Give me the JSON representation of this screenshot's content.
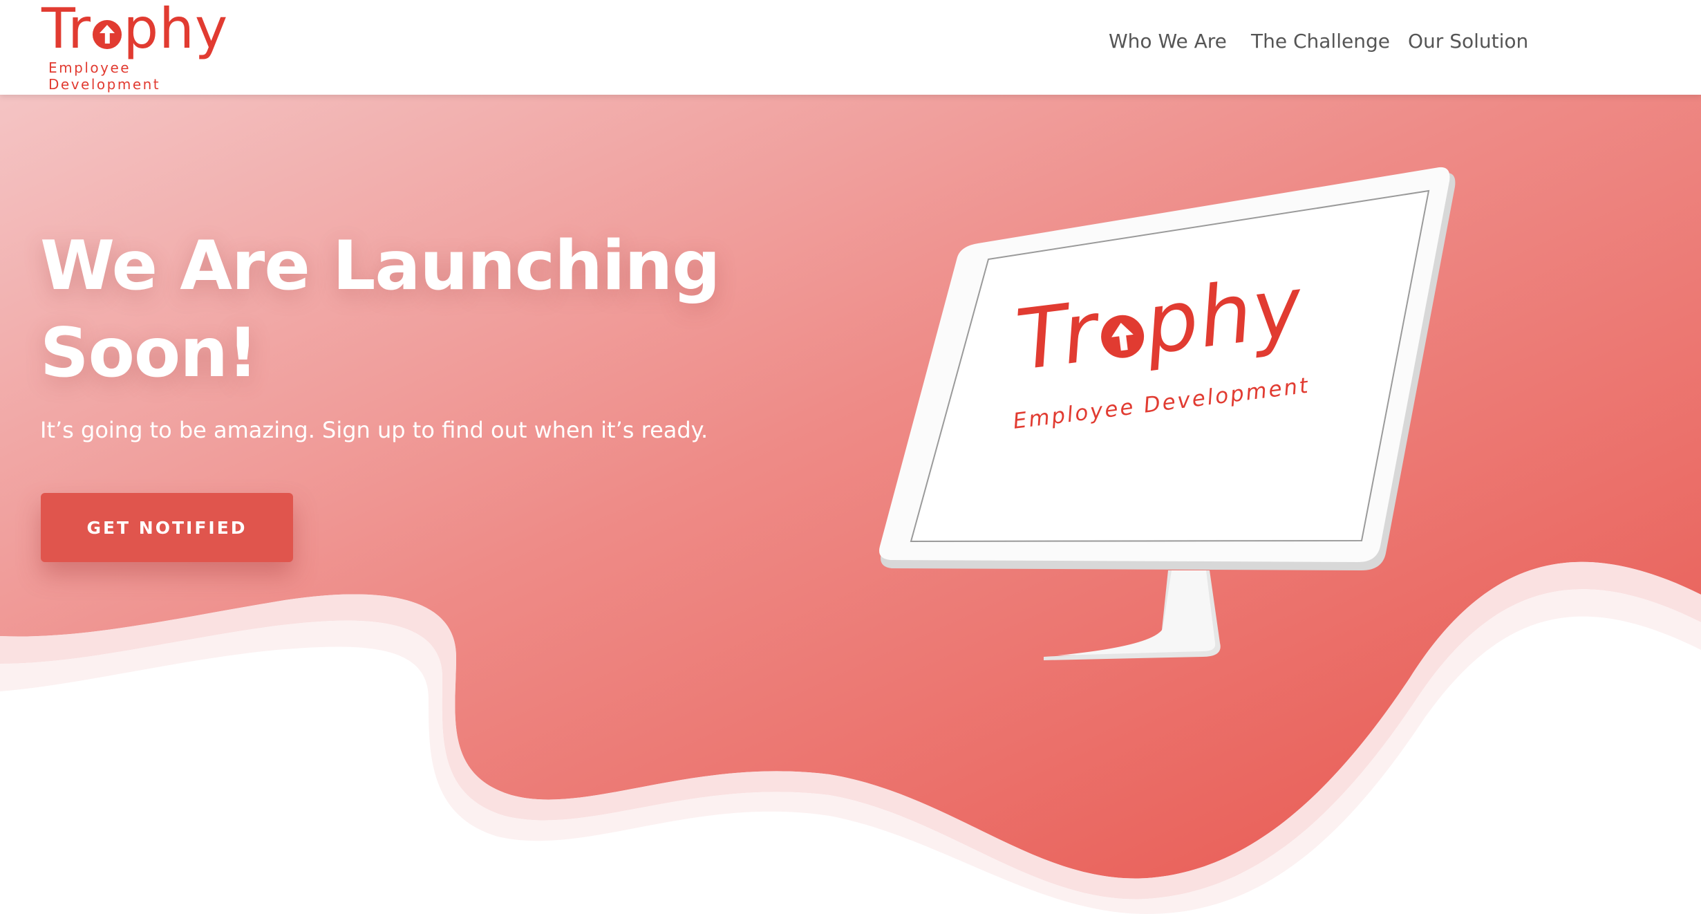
{
  "brand": {
    "name_part1": "Tr",
    "name_part2": "phy",
    "tagline": "Employee Development",
    "color": "#e13b31"
  },
  "nav": {
    "items": [
      {
        "label": "Who We Are"
      },
      {
        "label": "The Challenge"
      },
      {
        "label": "Our Solution"
      }
    ]
  },
  "hero": {
    "title_line1": "We Are Launching",
    "title_line2": "Soon!",
    "subtitle": "It’s going to be amazing. Sign up to find out when it’s ready.",
    "cta_label": "GET NOTIFIED",
    "gradient_start": "#f4c4c4",
    "gradient_end": "#e8554d",
    "button_color": "#e0554d"
  },
  "monitor_screen": {
    "name_part1": "Tr",
    "name_part2": "phy",
    "tagline": "Employee Development",
    "icon": "up-arrow-circle-icon"
  }
}
